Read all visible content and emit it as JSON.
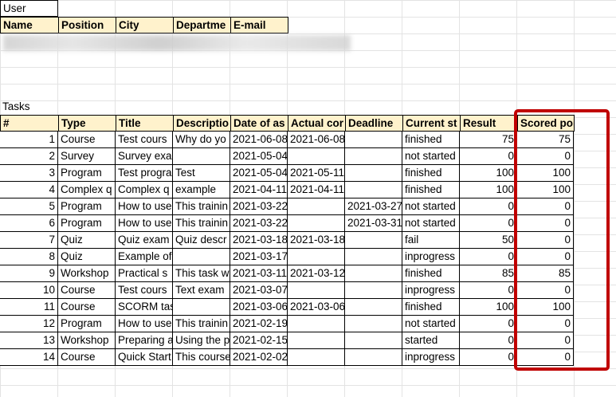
{
  "user_section": {
    "label": "User",
    "headers": [
      "Name",
      "Position",
      "City",
      "Departme",
      "E-mail"
    ]
  },
  "tasks_section": {
    "label": "Tasks",
    "headers": [
      "#",
      "Type",
      "Title",
      "Descriptio",
      "Date of as",
      "Actual cor",
      "Deadline",
      "Current st",
      "Result",
      "Scored points"
    ],
    "rows": [
      [
        "1",
        "Course",
        "Test cours",
        "Why do yo",
        "2021-06-08",
        "2021-06-08",
        "",
        "finished",
        "75",
        "75"
      ],
      [
        "2",
        "Survey",
        "Survey exa",
        "",
        "2021-05-04",
        "",
        "",
        "not started",
        "0",
        "0"
      ],
      [
        "3",
        "Program",
        "Test progra",
        "Test",
        "2021-05-04",
        "2021-05-11",
        "",
        "finished",
        "100",
        "100"
      ],
      [
        "4",
        "Complex q",
        "Complex q",
        "example",
        "2021-04-11",
        "2021-04-11",
        "",
        "finished",
        "100",
        "100"
      ],
      [
        "5",
        "Program",
        "How to use",
        "This trainin",
        "2021-03-22",
        "",
        "2021-03-27",
        "not started",
        "0",
        "0"
      ],
      [
        "6",
        "Program",
        "How to use",
        "This trainin",
        "2021-03-22",
        "",
        "2021-03-31",
        "not started",
        "0",
        "0"
      ],
      [
        "7",
        "Quiz",
        "Quiz exam",
        "Quiz descr",
        "2021-03-18",
        "2021-03-18",
        "",
        "fail",
        "50",
        "0"
      ],
      [
        "8",
        "Quiz",
        "Example of",
        "",
        "2021-03-17",
        "",
        "",
        "inprogress",
        "0",
        "0"
      ],
      [
        "9",
        "Workshop",
        "Practical s",
        "This task w",
        "2021-03-11",
        "2021-03-12",
        "",
        "finished",
        "85",
        "85"
      ],
      [
        "10",
        "Course",
        "Test cours",
        "Text exam",
        "2021-03-07",
        "",
        "",
        "inprogress",
        "0",
        "0"
      ],
      [
        "11",
        "Course",
        "SCORM tas",
        "",
        "2021-03-06",
        "2021-03-06",
        "",
        "finished",
        "100",
        "100"
      ],
      [
        "12",
        "Program",
        "How to use",
        "This trainin",
        "2021-02-19",
        "",
        "",
        "not started",
        "0",
        "0"
      ],
      [
        "13",
        "Workshop",
        "Preparing a",
        "Using the p",
        "2021-02-15",
        "",
        "",
        "started",
        "0",
        "0"
      ],
      [
        "14",
        "Course",
        "Quick Start",
        "This course",
        "2021-02-02",
        "",
        "",
        "inprogress",
        "0",
        "0"
      ]
    ]
  },
  "highlight_color": "#c00000",
  "header_fill": "#fff2cc"
}
